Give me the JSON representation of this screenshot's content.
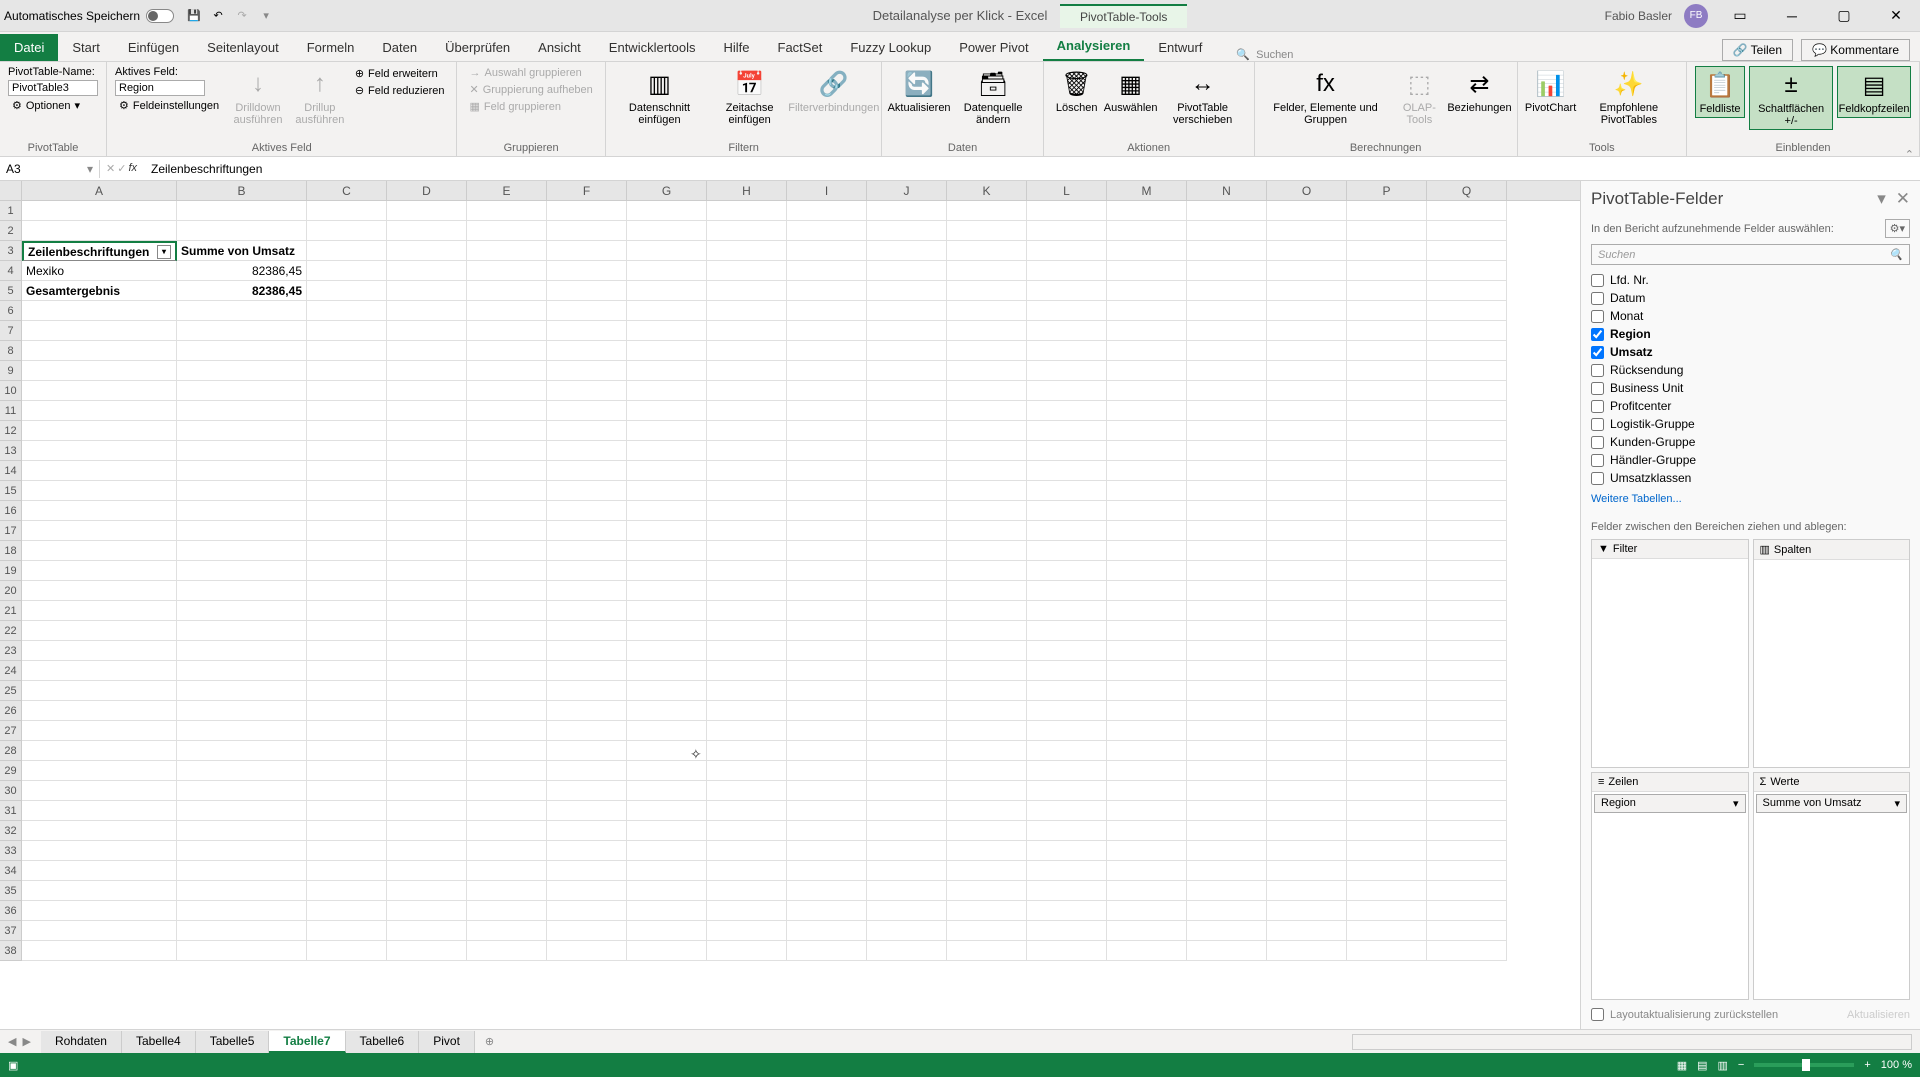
{
  "titlebar": {
    "autosave": "Automatisches Speichern",
    "doc_title": "Detailanalyse per Klick - Excel",
    "context_tool": "PivotTable-Tools",
    "user": "Fabio Basler",
    "user_initials": "FB"
  },
  "tabs": {
    "file": "Datei",
    "items": [
      "Start",
      "Einfügen",
      "Seitenlayout",
      "Formeln",
      "Daten",
      "Überprüfen",
      "Ansicht",
      "Entwicklertools",
      "Hilfe",
      "FactSet",
      "Fuzzy Lookup",
      "Power Pivot",
      "Analysieren",
      "Entwurf"
    ],
    "search": "Suchen",
    "teilen": "Teilen",
    "kommentare": "Kommentare"
  },
  "ribbon": {
    "pt_name_label": "PivotTable-Name:",
    "pt_name_value": "PivotTable3",
    "optionen": "Optionen",
    "group_pivottable": "PivotTable",
    "aktives_feld_label": "Aktives Feld:",
    "aktives_feld_value": "Region",
    "feldeinstellungen": "Feldeinstellungen",
    "drilldown": "Drilldown ausführen",
    "drillup": "Drillup ausführen",
    "feld_erweitern": "Feld erweitern",
    "feld_reduzieren": "Feld reduzieren",
    "group_aktives_feld": "Aktives Feld",
    "auswahl_gruppieren": "Auswahl gruppieren",
    "gruppierung_aufheben": "Gruppierung aufheben",
    "feld_gruppieren": "Feld gruppieren",
    "group_gruppieren": "Gruppieren",
    "datenschnitt": "Datenschnitt einfügen",
    "zeitachse": "Zeitachse einfügen",
    "filterverbindungen": "Filterverbindungen",
    "group_filtern": "Filtern",
    "aktualisieren": "Aktualisieren",
    "datenquelle": "Datenquelle ändern",
    "group_daten": "Daten",
    "loeschen": "Löschen",
    "auswaehlen": "Auswählen",
    "pt_verschieben": "PivotTable verschieben",
    "group_aktionen": "Aktionen",
    "felder_elemente": "Felder, Elemente und Gruppen",
    "olap": "OLAP-Tools",
    "beziehungen": "Beziehungen",
    "group_berechnungen": "Berechnungen",
    "pivotchart": "PivotChart",
    "empfohlene": "Empfohlene PivotTables",
    "group_tools": "Tools",
    "feldliste": "Feldliste",
    "schaltflaechen": "Schaltflächen +/-",
    "feldkopfzeilen": "Feldkopfzeilen",
    "group_einblenden": "Einblenden"
  },
  "namebox": "A3",
  "formula": "Zeilenbeschriftungen",
  "columns": [
    "A",
    "B",
    "C",
    "D",
    "E",
    "F",
    "G",
    "H",
    "I",
    "J",
    "K",
    "L",
    "M",
    "N",
    "O",
    "P",
    "Q"
  ],
  "pivot": {
    "row_labels_header": "Zeilenbeschriftungen",
    "value_header": "Summe von Umsatz",
    "rows": [
      {
        "label": "Mexiko",
        "value": "82386,45"
      }
    ],
    "total_label": "Gesamtergebnis",
    "total_value": "82386,45"
  },
  "field_pane": {
    "title": "PivotTable-Felder",
    "subtitle": "In den Bericht aufzunehmende Felder auswählen:",
    "search_placeholder": "Suchen",
    "fields": [
      {
        "name": "Lfd. Nr.",
        "checked": false
      },
      {
        "name": "Datum",
        "checked": false
      },
      {
        "name": "Monat",
        "checked": false
      },
      {
        "name": "Region",
        "checked": true
      },
      {
        "name": "Umsatz",
        "checked": true
      },
      {
        "name": "Rücksendung",
        "checked": false
      },
      {
        "name": "Business Unit",
        "checked": false
      },
      {
        "name": "Profitcenter",
        "checked": false
      },
      {
        "name": "Logistik-Gruppe",
        "checked": false
      },
      {
        "name": "Kunden-Gruppe",
        "checked": false
      },
      {
        "name": "Händler-Gruppe",
        "checked": false
      },
      {
        "name": "Umsatzklassen",
        "checked": false
      }
    ],
    "more_tables": "Weitere Tabellen...",
    "drag_label": "Felder zwischen den Bereichen ziehen und ablegen:",
    "area_filter": "Filter",
    "area_columns": "Spalten",
    "area_rows": "Zeilen",
    "area_values": "Werte",
    "rows_item": "Region",
    "values_item": "Summe von Umsatz",
    "defer": "Layoutaktualisierung zurückstellen",
    "update": "Aktualisieren"
  },
  "sheets": {
    "tabs": [
      "Rohdaten",
      "Tabelle4",
      "Tabelle5",
      "Tabelle7",
      "Tabelle6",
      "Pivot"
    ],
    "active": "Tabelle7"
  },
  "status": {
    "zoom": "100 %"
  }
}
